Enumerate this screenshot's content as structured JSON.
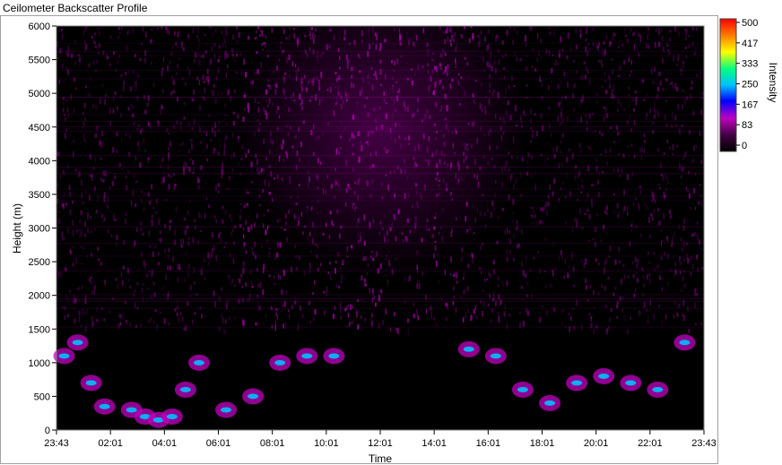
{
  "window_title": "Ceilometer Backscatter Profile",
  "chart_data": {
    "type": "heatmap",
    "title": "",
    "xlabel": "Time",
    "ylabel": "Height (m)",
    "ylim": [
      0,
      6000
    ],
    "y_ticks": [
      "0",
      "500",
      "1000",
      "1500",
      "2000",
      "2500",
      "3000",
      "3500",
      "4000",
      "4500",
      "5000",
      "5500",
      "6000"
    ],
    "x_ticks": [
      "23:43",
      "02:01",
      "04:01",
      "06:01",
      "08:01",
      "10:01",
      "12:01",
      "14:01",
      "16:01",
      "18:01",
      "20:01",
      "22:01",
      "23:43"
    ],
    "colorbar": {
      "label": "Intensity",
      "ticks": [
        "500",
        "417",
        "333",
        "250",
        "167",
        "83",
        "0"
      ],
      "range": [
        0,
        500
      ],
      "colors": [
        "#000000",
        "#c000c0",
        "#0000ff",
        "#00c0ff",
        "#00ff80",
        "#ffff00",
        "#ff8000",
        "#ff0000"
      ]
    },
    "background_color": "#000000",
    "noise_color": "#c000c0",
    "cloud_layer": [
      {
        "time": "00:00",
        "height": 1100
      },
      {
        "time": "00:30",
        "height": 1300
      },
      {
        "time": "01:00",
        "height": 700
      },
      {
        "time": "01:30",
        "height": 350
      },
      {
        "time": "02:30",
        "height": 300
      },
      {
        "time": "03:00",
        "height": 200
      },
      {
        "time": "03:30",
        "height": 150
      },
      {
        "time": "04:00",
        "height": 200
      },
      {
        "time": "04:30",
        "height": 600
      },
      {
        "time": "05:00",
        "height": 1000
      },
      {
        "time": "06:00",
        "height": 300
      },
      {
        "time": "07:00",
        "height": 500
      },
      {
        "time": "08:00",
        "height": 1000
      },
      {
        "time": "09:00",
        "height": 1100
      },
      {
        "time": "10:00",
        "height": 1100
      },
      {
        "time": "15:00",
        "height": 1200
      },
      {
        "time": "16:00",
        "height": 1100
      },
      {
        "time": "17:00",
        "height": 600
      },
      {
        "time": "18:00",
        "height": 400
      },
      {
        "time": "19:00",
        "height": 700
      },
      {
        "time": "20:00",
        "height": 800
      },
      {
        "time": "21:00",
        "height": 700
      },
      {
        "time": "22:00",
        "height": 600
      },
      {
        "time": "23:00",
        "height": 1300
      }
    ]
  }
}
